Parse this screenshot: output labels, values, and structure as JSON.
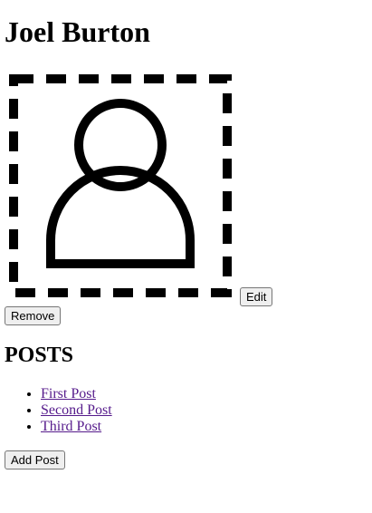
{
  "profile": {
    "name": "Joel Burton",
    "edit_label": "Edit",
    "remove_label": "Remove"
  },
  "posts": {
    "heading": "POSTS",
    "items": [
      {
        "title": "First Post"
      },
      {
        "title": "Second Post"
      },
      {
        "title": "Third Post"
      }
    ],
    "add_label": "Add Post"
  },
  "colors": {
    "link": "#551a8b",
    "button_background": "#efefef",
    "button_border": "#767676"
  },
  "icons": {
    "avatar": "user-placeholder-icon"
  }
}
